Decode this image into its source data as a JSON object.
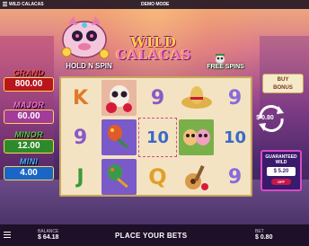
{
  "topbar": {
    "game_title": "WILD CALACAS",
    "mode": "DEMO MODE"
  },
  "features": {
    "hold_n_spin": "HOLD N SPIN",
    "free_spins": "FREE SPINS"
  },
  "logo": {
    "line1": "WILD",
    "line2": "CALACAS"
  },
  "jackpots": [
    {
      "label": "GRAND",
      "value": "800.00",
      "color": "#b8151d"
    },
    {
      "label": "MAJOR",
      "value": "60.00",
      "color": "#a33b9b"
    },
    {
      "label": "MINOR",
      "value": "12.00",
      "color": "#2d8a2a"
    },
    {
      "label": "MINI",
      "value": "4.00",
      "color": "#1a66c8"
    }
  ],
  "reels": {
    "rows": [
      [
        "K",
        "skull-rose",
        "9",
        "sombrero",
        "9"
      ],
      [
        "9",
        "maracas",
        "10",
        "sugar-skulls",
        "10"
      ],
      [
        "J",
        "maracas",
        "Q",
        "guitar",
        "9"
      ]
    ]
  },
  "buy_bonus": {
    "line1": "BUY",
    "line2": "BONUS"
  },
  "spin": {
    "amount": "$ 0.80"
  },
  "guaranteed_wild": {
    "line1": "GUARANTEED",
    "line2": "WILD",
    "amount": "$ 5.20",
    "toggle": "OFF"
  },
  "bottom": {
    "balance_label": "BALANCE",
    "balance_value": "$ 64.18",
    "message": "PLACE YOUR BETS",
    "bet_label": "BET",
    "bet_value": "$ 0.80"
  }
}
